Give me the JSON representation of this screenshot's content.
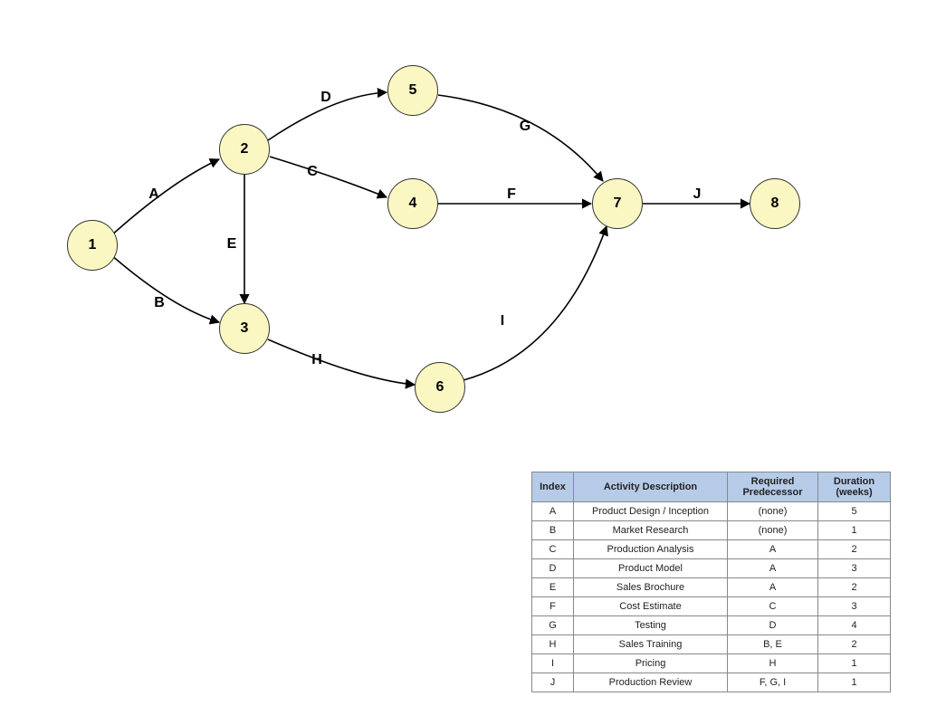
{
  "nodes": {
    "n1": "1",
    "n2": "2",
    "n3": "3",
    "n4": "4",
    "n5": "5",
    "n6": "6",
    "n7": "7",
    "n8": "8"
  },
  "edges": {
    "A": "A",
    "B": "B",
    "C": "C",
    "D": "D",
    "E": "E",
    "F": "F",
    "G": "G",
    "H": "H",
    "I": "I",
    "J": "J"
  },
  "table": {
    "headers": {
      "index": "Index",
      "desc": "Activity Description",
      "pred": "Required Predecessor",
      "dur": "Duration (weeks)"
    },
    "rows": [
      {
        "index": "A",
        "desc": "Product Design / Inception",
        "pred": "(none)",
        "dur": "5"
      },
      {
        "index": "B",
        "desc": "Market Research",
        "pred": "(none)",
        "dur": "1"
      },
      {
        "index": "C",
        "desc": "Production Analysis",
        "pred": "A",
        "dur": "2"
      },
      {
        "index": "D",
        "desc": "Product Model",
        "pred": "A",
        "dur": "3"
      },
      {
        "index": "E",
        "desc": "Sales Brochure",
        "pred": "A",
        "dur": "2"
      },
      {
        "index": "F",
        "desc": "Cost Estimate",
        "pred": "C",
        "dur": "3"
      },
      {
        "index": "G",
        "desc": "Testing",
        "pred": "D",
        "dur": "4"
      },
      {
        "index": "H",
        "desc": "Sales Training",
        "pred": "B, E",
        "dur": "2"
      },
      {
        "index": "I",
        "desc": "Pricing",
        "pred": "H",
        "dur": "1"
      },
      {
        "index": "J",
        "desc": "Production Review",
        "pred": "F, G, I",
        "dur": "1"
      }
    ]
  },
  "chart_data": {
    "type": "table",
    "description": "Activity-on-arrow network diagram with 8 event nodes and 10 activities A–J",
    "nodes": [
      1,
      2,
      3,
      4,
      5,
      6,
      7,
      8
    ],
    "activities": [
      {
        "id": "A",
        "from": 1,
        "to": 2,
        "desc": "Product Design / Inception",
        "pred": "(none)",
        "duration_weeks": 5
      },
      {
        "id": "B",
        "from": 1,
        "to": 3,
        "desc": "Market Research",
        "pred": "(none)",
        "duration_weeks": 1
      },
      {
        "id": "C",
        "from": 2,
        "to": 4,
        "desc": "Production Analysis",
        "pred": "A",
        "duration_weeks": 2
      },
      {
        "id": "D",
        "from": 2,
        "to": 5,
        "desc": "Product Model",
        "pred": "A",
        "duration_weeks": 3
      },
      {
        "id": "E",
        "from": 2,
        "to": 3,
        "desc": "Sales Brochure",
        "pred": "A",
        "duration_weeks": 2
      },
      {
        "id": "F",
        "from": 4,
        "to": 7,
        "desc": "Cost Estimate",
        "pred": "C",
        "duration_weeks": 3
      },
      {
        "id": "G",
        "from": 5,
        "to": 7,
        "desc": "Testing",
        "pred": "D",
        "duration_weeks": 4
      },
      {
        "id": "H",
        "from": 3,
        "to": 6,
        "desc": "Sales Training",
        "pred": "B, E",
        "duration_weeks": 2
      },
      {
        "id": "I",
        "from": 6,
        "to": 7,
        "desc": "Pricing",
        "pred": "H",
        "duration_weeks": 1
      },
      {
        "id": "J",
        "from": 7,
        "to": 8,
        "desc": "Production Review",
        "pred": "F, G, I",
        "duration_weeks": 1
      }
    ]
  }
}
